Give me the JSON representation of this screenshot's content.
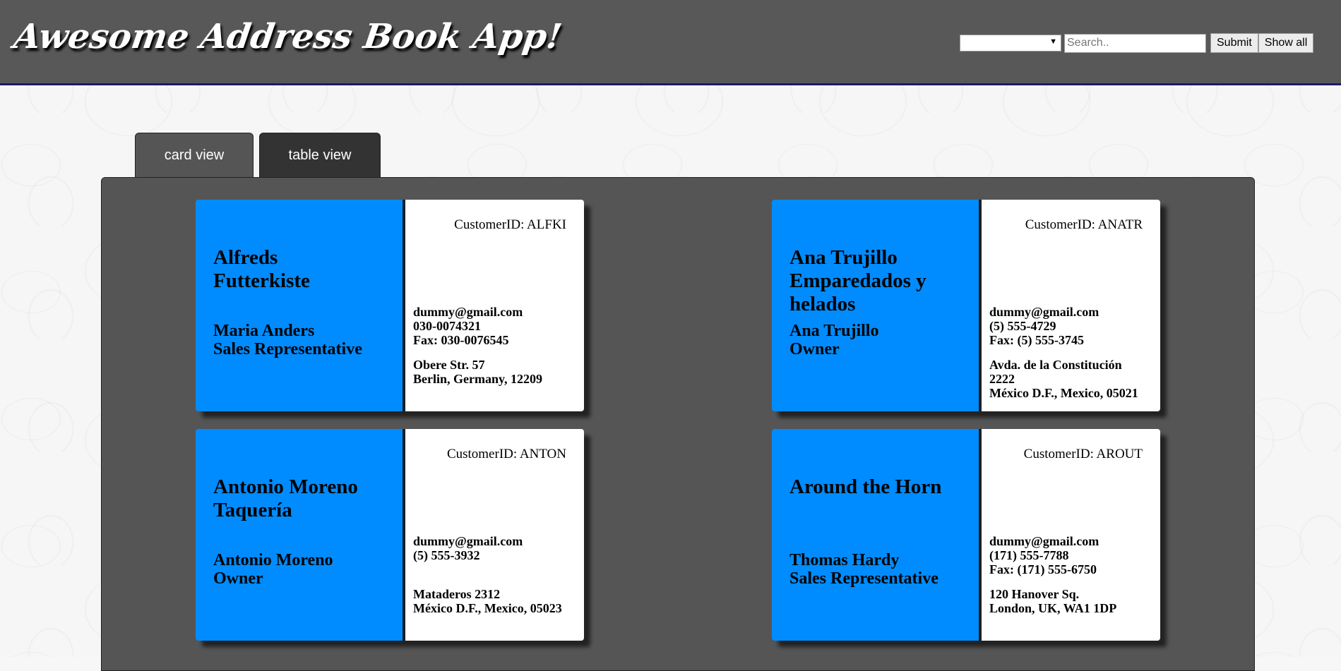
{
  "header": {
    "title": "Awesome Address Book App!",
    "filter_value": "",
    "search_placeholder": "Search..",
    "submit_label": "Submit",
    "show_all_label": "Show all"
  },
  "tabs": [
    {
      "label": "card view",
      "active": true
    },
    {
      "label": "table view",
      "active": false
    }
  ],
  "colors": {
    "header_bg": "#585858",
    "card_accent": "#008cff",
    "panel_bg": "#555555"
  },
  "cards": [
    {
      "company_line1": "Alfreds",
      "company_line2": "Futterkiste",
      "company_line3": "",
      "contact_name": "Maria Anders",
      "contact_title": "Sales Representative",
      "customer_id": "CustomerID: ALFKI",
      "email": "dummy@gmail.com",
      "phone": "030-0074321",
      "fax": "Fax: 030-0076545",
      "address_line1": "Obere Str. 57",
      "address_line2": "Berlin, Germany, 12209",
      "address_line3": ""
    },
    {
      "company_line1": "Ana Trujillo",
      "company_line2": "Emparedados y",
      "company_line3": "helados",
      "contact_name": "Ana Trujillo",
      "contact_title": "Owner",
      "customer_id": "CustomerID: ANATR",
      "email": "dummy@gmail.com",
      "phone": "(5) 555-4729",
      "fax": "Fax: (5) 555-3745",
      "address_line1": "Avda. de la Constitución",
      "address_line2": "2222",
      "address_line3": "México D.F., Mexico, 05021"
    },
    {
      "company_line1": "Antonio Moreno",
      "company_line2": "Taquería",
      "company_line3": "",
      "contact_name": "Antonio Moreno",
      "contact_title": "Owner",
      "customer_id": "CustomerID: ANTON",
      "email": "dummy@gmail.com",
      "phone": "(5) 555-3932",
      "fax": "",
      "address_line1": "Mataderos 2312",
      "address_line2": "México D.F., Mexico, 05023",
      "address_line3": ""
    },
    {
      "company_line1": "Around the Horn",
      "company_line2": "",
      "company_line3": "",
      "contact_name": "Thomas Hardy",
      "contact_title": "Sales Representative",
      "customer_id": "CustomerID: AROUT",
      "email": "dummy@gmail.com",
      "phone": "(171) 555-7788",
      "fax": "Fax: (171) 555-6750",
      "address_line1": "120 Hanover Sq.",
      "address_line2": "London, UK, WA1 1DP",
      "address_line3": ""
    }
  ]
}
